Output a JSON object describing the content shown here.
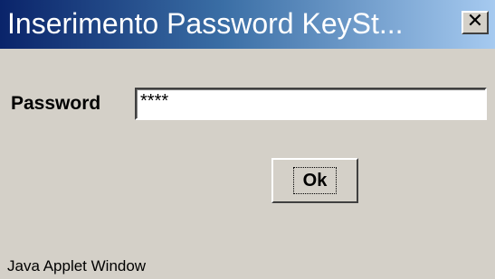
{
  "window": {
    "title": "Inserimento Password KeySt...",
    "close_glyph": "✕"
  },
  "form": {
    "password_label": "Password",
    "password_value": "****"
  },
  "actions": {
    "ok_label": "Ok"
  },
  "status": {
    "applet_warning": "Java Applet Window"
  },
  "colors": {
    "titlebar_start": "#0a246a",
    "titlebar_end": "#a6caf0",
    "window_background": "#d4d0c8",
    "field_background": "#ffffff"
  },
  "icons": {
    "close": "close-icon"
  }
}
